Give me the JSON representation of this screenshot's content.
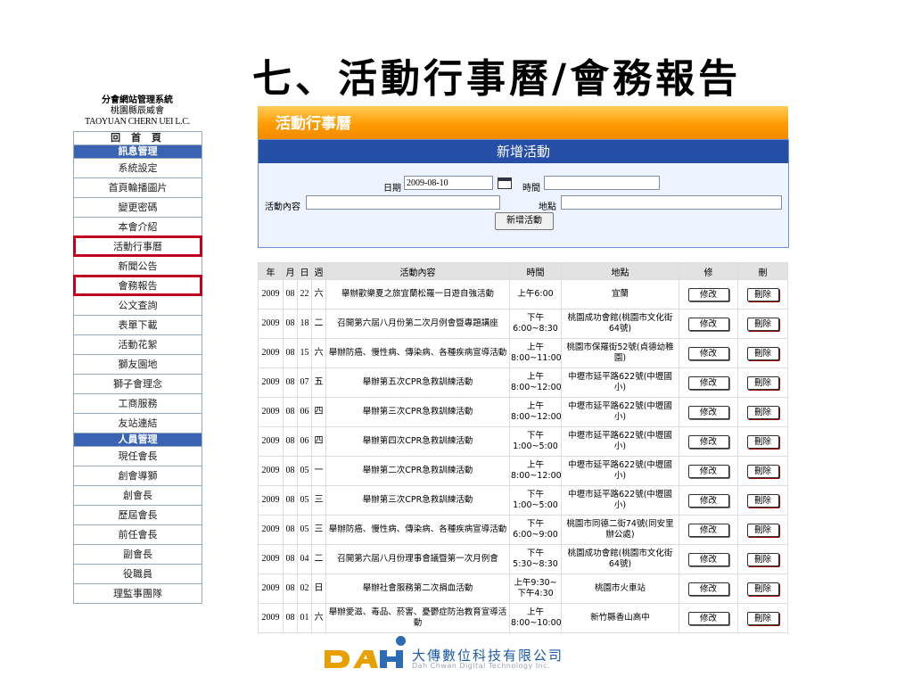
{
  "slide_title": "七、活動行事曆/會務報告",
  "nav": {
    "header_line1": "分會網站管理系統",
    "header_line2": "桃園縣辰威會",
    "header_line3": "TAOYUAN CHERN UEI L.C.",
    "home": "回 首 頁",
    "section_info": "訊息管理",
    "info_items": [
      "系統設定",
      "首頁輪播圖片",
      "變更密碼",
      "本會介紹",
      "活動行事曆",
      "新聞公告",
      "會務報告",
      "公文查詢",
      "表單下載",
      "活動花絮",
      "獅友園地",
      "獅子會理念",
      "工商服務",
      "友站連結"
    ],
    "section_people": "人員管理",
    "people_items": [
      "現任會長",
      "創會導獅",
      "創會長",
      "歷屆會長",
      "前任會長",
      "副會長",
      "役職員",
      "理監事團隊"
    ]
  },
  "banner_title": "活動行事曆",
  "form": {
    "heading": "新增活動",
    "date_label": "日期",
    "date_value": "2009-08-10",
    "time_label": "時間",
    "time_value": "",
    "content_label": "活動內容",
    "content_value": "",
    "place_label": "地點",
    "place_value": "",
    "submit_label": "新增活動"
  },
  "table": {
    "headers": [
      "年",
      "月",
      "日",
      "週",
      "活動內容",
      "時間",
      "地點",
      "修",
      "刪"
    ],
    "edit_label": "修改",
    "delete_label": "刪除",
    "rows": [
      [
        "2009",
        "08",
        "22",
        "六",
        "舉辦歡樂夏之旅宜蘭松羅一日遊自強活動",
        "上午6:00",
        "宜蘭"
      ],
      [
        "2009",
        "08",
        "18",
        "二",
        "召開第六屆八月份第二次月例會暨專題講座",
        "下午 6:00~8:30",
        "桃園成功會館(桃園市文化街64號)"
      ],
      [
        "2009",
        "08",
        "15",
        "六",
        "舉辦防癌、慢性病、傳染病、各種疾病宣導活動",
        "上午 8:00~11:00",
        "桃園市保羅街52號(貞德幼稚園)"
      ],
      [
        "2009",
        "08",
        "07",
        "五",
        "舉辦第五次CPR急救訓練活動",
        "上午 8:00~12:00",
        "中壢市延平路622號(中壢國小)"
      ],
      [
        "2009",
        "08",
        "06",
        "四",
        "舉辦第三次CPR急救訓練活動",
        "上午 8:00~12:00",
        "中壢市延平路622號(中壢國小)"
      ],
      [
        "2009",
        "08",
        "06",
        "四",
        "舉辦第四次CPR急救訓練活動",
        "下午 1:00~5:00",
        "中壢市延平路622號(中壢國小)"
      ],
      [
        "2009",
        "08",
        "05",
        "一",
        "舉辦第二次CPR急救訓練活動",
        "上午 8:00~12:00",
        "中壢市延平路622號(中壢國小)"
      ],
      [
        "2009",
        "08",
        "05",
        "三",
        "舉辦第三次CPR急救訓練活動",
        "下午 1:00~5:00",
        "中壢市延平路622號(中壢國小)"
      ],
      [
        "2009",
        "08",
        "05",
        "三",
        "舉辦防癌、慢性病、傳染病、各種疾病宣導活動",
        "下午 6:00~9:00",
        "桃園市同德二街74號(同安里辦公處)"
      ],
      [
        "2009",
        "08",
        "04",
        "二",
        "召開第六屆八月份理事會議暨第一次月例會",
        "下午 5:30~8:30",
        "桃園成功會館(桃園市文化街64號)"
      ],
      [
        "2009",
        "08",
        "02",
        "日",
        "舉辦社會服務第二次捐血活動",
        "上午9:30~下午4:30",
        "桃園市火車站"
      ],
      [
        "2009",
        "08",
        "01",
        "六",
        "舉辦愛滋、毒品、菸害、憂鬱症防治教育宣導活動",
        "上午 8:00~10:00",
        "新竹縣香山高中"
      ]
    ]
  },
  "logo": {
    "mark": "DAH",
    "chinese": "大傳數位科技有限公司",
    "english": "Dah Chwan Digital Technology Inc."
  },
  "colors": {
    "nav_section": "#3a63b4",
    "banner": "#ff9a00",
    "form_head": "#254ea6",
    "highlight": "#c0001e"
  }
}
